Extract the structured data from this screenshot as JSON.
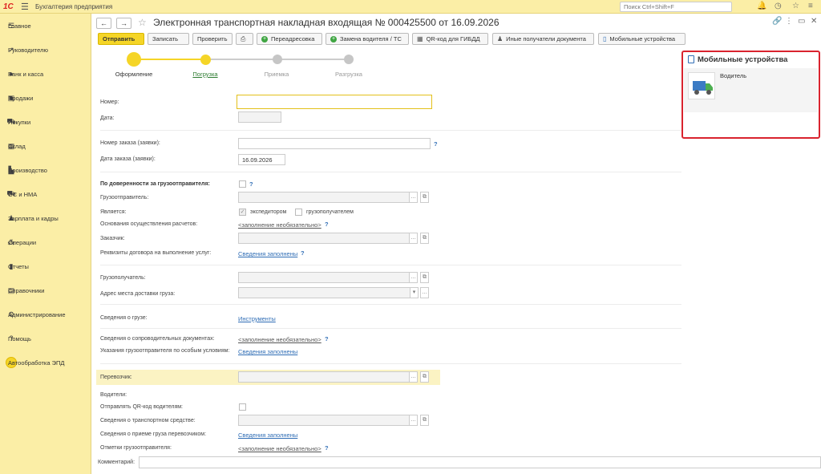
{
  "topbar": {
    "logo": "1С",
    "app_title": "Бухгалтерия предприятия",
    "search_placeholder": "Поиск Ctrl+Shift+F"
  },
  "sidebar": {
    "items": [
      {
        "label": "Главное",
        "icon": "menu-icon",
        "glyph": "☰"
      },
      {
        "label": "Руководителю",
        "icon": "trend-icon",
        "glyph": "↗"
      },
      {
        "label": "Банк и касса",
        "icon": "bank-icon",
        "glyph": "●"
      },
      {
        "label": "Продажи",
        "icon": "bag-icon",
        "glyph": "▣"
      },
      {
        "label": "Покупки",
        "icon": "cart-icon",
        "glyph": "⛟"
      },
      {
        "label": "Склад",
        "icon": "warehouse-icon",
        "glyph": "▦"
      },
      {
        "label": "Производство",
        "icon": "factory-icon",
        "glyph": "▙"
      },
      {
        "label": "ОС и НМА",
        "icon": "truck-icon",
        "glyph": "⛟"
      },
      {
        "label": "Зарплата и кадры",
        "icon": "person-icon",
        "glyph": "♟"
      },
      {
        "label": "Операции",
        "icon": "operations-icon",
        "glyph": "⁂"
      },
      {
        "label": "Отчеты",
        "icon": "chart-icon",
        "glyph": "▮"
      },
      {
        "label": "Справочники",
        "icon": "book-icon",
        "glyph": "▤"
      },
      {
        "label": "Администрирование",
        "icon": "gear-icon",
        "glyph": "⚙"
      },
      {
        "label": "Помощь",
        "icon": "help-icon",
        "glyph": "?"
      },
      {
        "label": "Автообработка ЭПД",
        "icon": "yellow-circle-icon",
        "glyph": ""
      }
    ]
  },
  "document": {
    "title": "Электронная транспортная накладная входящая № 000425500 от 16.09.2026"
  },
  "toolbar": {
    "send": "Отправить",
    "save": "Записать",
    "check": "Проверить",
    "readdress": "Переадресовка",
    "replace_driver": "Замена водителя / ТС",
    "qr": "QR-код для ГИБДД",
    "other_recipients": "Иные получатели документа",
    "mobile_devices": "Мобильные устройства"
  },
  "steps": [
    {
      "label": "Оформление",
      "state": "done"
    },
    {
      "label": "Погрузка",
      "state": "current"
    },
    {
      "label": "Приемка",
      "state": "pending"
    },
    {
      "label": "Разгрузка",
      "state": "pending"
    }
  ],
  "form": {
    "number_label": "Номер:",
    "number_value": "",
    "date_label": "Дата:",
    "date_value": "",
    "order_number_label": "Номер заказа (заявки):",
    "order_number_value": "",
    "order_date_label": "Дата заказа (заявки):",
    "order_date_value": "16.09.2026",
    "proxy_label": "По доверенности за грузоотправителя:",
    "shipper_label": "Грузоотправитель:",
    "shipper_value": "",
    "is_label": "Является:",
    "forwarder_label": "экспедитором",
    "consignee_chk_label": "грузополучателем",
    "settlement_label": "Основания осуществления расчетов:",
    "settlement_link": "<заполнение необязательно>",
    "customer_label": "Заказчик:",
    "customer_value": "",
    "contract_label": "Реквизиты договора на выполнение услуг:",
    "contract_link": "Сведения заполнены",
    "consignee_label": "Грузополучатель:",
    "consignee_value": "",
    "address_label": "Адрес места доставки груза:",
    "address_value": "",
    "cargo_label": "Сведения о грузе:",
    "cargo_link": "Инструменты",
    "docs_label": "Сведения о сопроводительных документах:",
    "docs_link": "<заполнение необязательно>",
    "special_label": "Указания грузоотправителя по особым условиям:",
    "special_link": "Сведения заполнены",
    "carrier_label": "Перевозчик:",
    "carrier_value": "",
    "drivers_label": "Водители:",
    "drivers_value": "",
    "send_qr_label": "Отправлять QR-код водителям:",
    "vehicle_label": "Сведения о транспортном средстве:",
    "vehicle_value": "",
    "acceptance_label": "Сведения о приеме груза перевозчиком:",
    "acceptance_link": "Сведения заполнены",
    "marks_label": "Отметки грузоотправителя:",
    "marks_link": "<заполнение необязательно>",
    "comment_label": "Комментарий:",
    "comment_value": ""
  },
  "mobile_panel": {
    "title": "Мобильные устройства",
    "driver_label": "Водитель",
    "driver_name": ""
  },
  "colors": {
    "accent_yellow": "#f5d527",
    "panel_border": "#d9232e",
    "link": "#2f6db5",
    "sidebar_bg": "#fbeea6"
  }
}
